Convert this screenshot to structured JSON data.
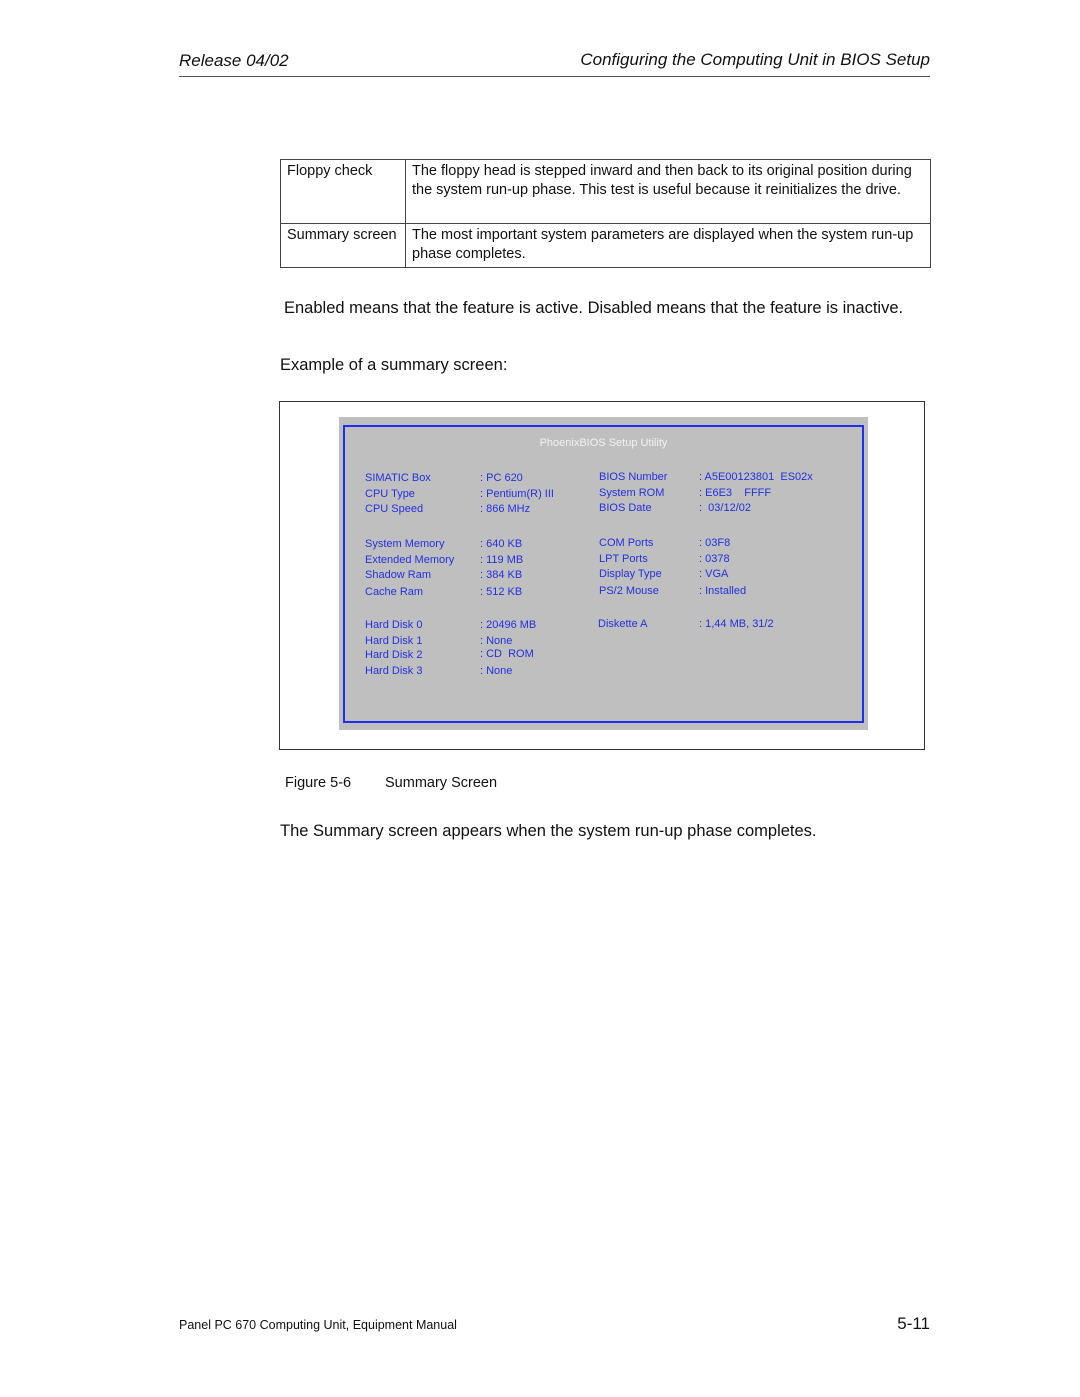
{
  "header": {
    "release": "Release 04/02",
    "section_title": "Configuring the Computing Unit in BIOS Setup"
  },
  "definition_table": {
    "rows": [
      {
        "term": "Floppy check",
        "description": "The floppy head is stepped inward and then back to its original position during the system run-up phase. This test is useful because it reinitializes the drive."
      },
      {
        "term": "Summary screen",
        "description": "The most important system parameters are displayed when the system run-up phase completes."
      }
    ]
  },
  "paragraphs": {
    "enabled_disabled": "Enabled  means that the feature is active.  Disabled  means that the feature is inactive.",
    "example_intro": "Example of a summary screen:",
    "closing": "The Summary screen appears when the system run-up phase completes."
  },
  "bios_screen": {
    "title": "PhoenixBIOS Setup Utility",
    "colors": {
      "background": "#bfbfbf",
      "border": "#1f2ef0",
      "text": "#2330e0",
      "title": "#f2f2f2"
    },
    "left_column": [
      {
        "label": "SIMATIC Box",
        "value": ": PC 620"
      },
      {
        "label": "CPU Type",
        "value": ": Pentium(R) III"
      },
      {
        "label": "CPU Speed",
        "value": ": 866 MHz"
      },
      {
        "label": "System Memory",
        "value": ": 640 KB"
      },
      {
        "label": "Extended Memory",
        "value": ": 119 MB"
      },
      {
        "label": "Shadow Ram",
        "value": ": 384 KB"
      },
      {
        "label": "Cache Ram",
        "value": ": 512 KB"
      },
      {
        "label": "Hard Disk 0",
        "value": ": 20496 MB"
      },
      {
        "label": "Hard Disk 1",
        "value": ": None"
      },
      {
        "label": "Hard Disk 2",
        "value": ": CD  ROM"
      },
      {
        "label": "Hard Disk 3",
        "value": ": None"
      }
    ],
    "right_column": [
      {
        "label": "BIOS Number",
        "value": ": A5E00123801  ES02x"
      },
      {
        "label": "System ROM",
        "value": ": E6E3    FFFF"
      },
      {
        "label": "BIOS Date",
        "value": ":  03/12/02"
      },
      {
        "label": "COM Ports",
        "value": ": 03F8"
      },
      {
        "label": "LPT Ports",
        "value": ": 0378"
      },
      {
        "label": "Display Type",
        "value": ": VGA"
      },
      {
        "label": "PS/2 Mouse",
        "value": ": Installed"
      },
      {
        "label": "Diskette A",
        "value": ": 1,44 MB, 31/2"
      }
    ]
  },
  "figure": {
    "number": "Figure 5-6",
    "caption": "Summary Screen"
  },
  "footer": {
    "manual_title": "Panel PC 670 Computing Unit, Equipment Manual",
    "page_number": "5-11"
  }
}
